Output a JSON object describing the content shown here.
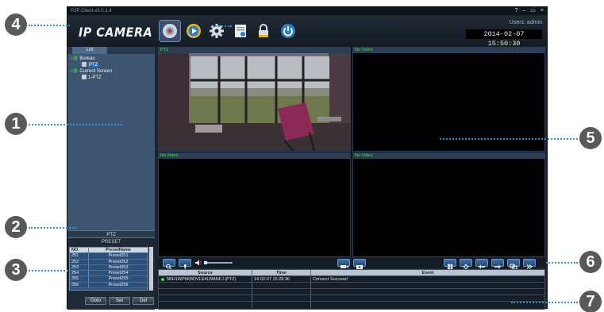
{
  "app": {
    "title": "P2P Client-v3.0.1.4",
    "brand": "IP CAMERA",
    "window_controls": [
      "?",
      "–",
      "▭",
      "×"
    ],
    "users": "Users: admin",
    "datetime": "2014-02-07  15:50:30",
    "toolbar_icons": [
      "live-view-icon",
      "playback-icon",
      "settings-icon",
      "log-icon",
      "lock-icon",
      "power-icon"
    ]
  },
  "sidebar": {
    "tab": "List",
    "tree": [
      {
        "label": "Bureau"
      },
      {
        "label": "PTZ"
      },
      {
        "label": "Current Screen"
      },
      {
        "label": "1-PTZ"
      }
    ],
    "ptz_label": "PTZ",
    "preset": {
      "title": "PRESET",
      "headers": [
        "NO.",
        "PresetName"
      ],
      "rows": [
        [
          "251",
          "Preset251"
        ],
        [
          "252",
          "Preset252"
        ],
        [
          "253",
          "Preset253"
        ],
        [
          "254",
          "Preset254"
        ],
        [
          "255",
          "Preset255"
        ],
        [
          "256",
          "Preset256"
        ]
      ],
      "buttons": [
        "Goto",
        "Set",
        "Del"
      ]
    }
  },
  "video": {
    "panes": [
      {
        "label": "PTZ"
      },
      {
        "label": "No Video"
      },
      {
        "label": "No Video"
      },
      {
        "label": "No Video"
      }
    ]
  },
  "events": {
    "headers": [
      "Source",
      "Time",
      "Event"
    ],
    "rows": [
      [
        "5BH1WP6KBDVLE4LWANFJ (PTZ)",
        "14-02-07 15:28:36",
        "Connect Success!"
      ]
    ]
  },
  "callouts": [
    "1",
    "2",
    "3",
    "4",
    "5",
    "6",
    "7"
  ],
  "colors": {
    "callout": "#58595b",
    "leader": "#2f8fd0",
    "no_video_text": "#3ee04a",
    "sidebar": "#3e5572"
  }
}
